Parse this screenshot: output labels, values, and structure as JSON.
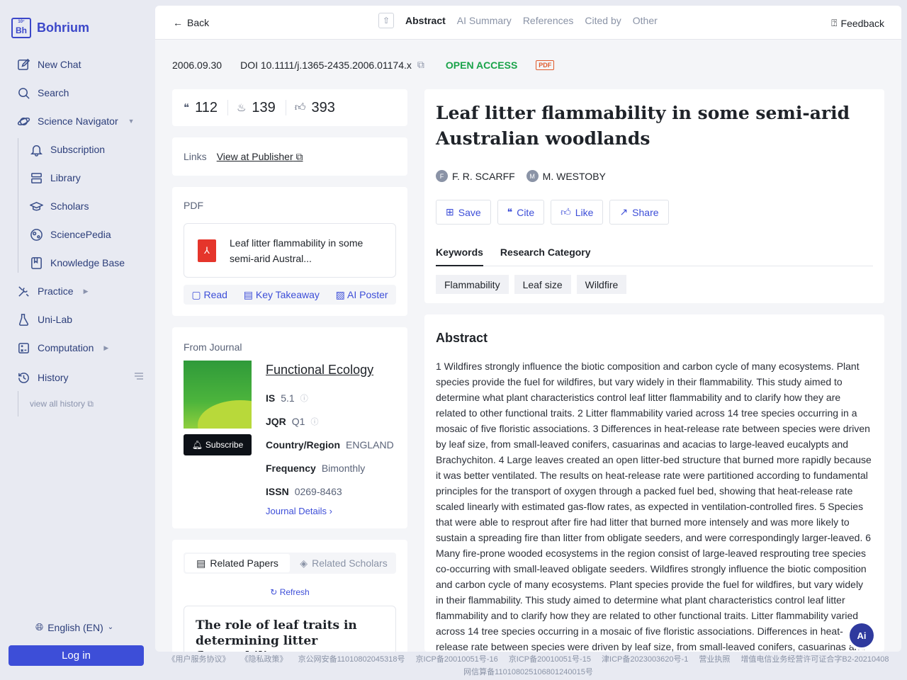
{
  "app": {
    "name": "Bohrium",
    "logo_text": "Bh",
    "logo_small": "10⁷"
  },
  "sidebar": {
    "items": [
      {
        "label": "New Chat",
        "icon": "edit-icon"
      },
      {
        "label": "Search",
        "icon": "search-icon"
      },
      {
        "label": "Science Navigator",
        "icon": "planet-icon"
      },
      {
        "label": "Subscription",
        "icon": "bell-icon"
      },
      {
        "label": "Library",
        "icon": "library-icon"
      },
      {
        "label": "Scholars",
        "icon": "graduation-cap-icon"
      },
      {
        "label": "SciencePedia",
        "icon": "globe-icon"
      },
      {
        "label": "Knowledge Base",
        "icon": "book-icon"
      },
      {
        "label": "Practice",
        "icon": "tools-icon"
      },
      {
        "label": "Uni-Lab",
        "icon": "flask-icon"
      },
      {
        "label": "Computation",
        "icon": "calculator-icon"
      },
      {
        "label": "History",
        "icon": "history-icon"
      }
    ],
    "view_all_history": "view all history",
    "language": "English (EN)",
    "login": "Log in"
  },
  "topbar": {
    "back": "Back",
    "tabs": [
      "Abstract",
      "AI Summary",
      "References",
      "Cited by",
      "Other"
    ],
    "active_tab": "Abstract",
    "feedback": "Feedback"
  },
  "meta": {
    "date": "2006.09.30",
    "doi": "DOI 10.1111/j.1365-2435.2006.01174.x",
    "open_access": "OPEN ACCESS",
    "pdf_badge": "PDF"
  },
  "stats": {
    "citations": "112",
    "hot": "139",
    "likes": "393"
  },
  "links": {
    "label": "Links",
    "publisher": "View at Publisher"
  },
  "pdf": {
    "label": "PDF",
    "title": "Leaf litter flammability in some semi-arid Austral...",
    "actions": [
      "Read",
      "Key Takeaway",
      "AI Poster"
    ]
  },
  "journal": {
    "label": "From Journal",
    "name": "Functional Ecology",
    "subscribe": "Subscribe",
    "rows": [
      {
        "key": "IS",
        "value": "5.1"
      },
      {
        "key": "JQR",
        "value": "Q1"
      },
      {
        "key": "Country/Region",
        "value": "ENGLAND"
      },
      {
        "key": "Frequency",
        "value": "Bimonthly"
      },
      {
        "key": "ISSN",
        "value": "0269-8463"
      }
    ],
    "details": "Journal Details"
  },
  "related": {
    "tabs": [
      "Related Papers",
      "Related Scholars"
    ],
    "refresh": "Refresh",
    "first_title": "The role of leaf traits in determining litter flammability"
  },
  "paper": {
    "title": "Leaf litter flammability in some semi-arid Australian woodlands",
    "authors": [
      {
        "initial": "F",
        "name": "F. R. SCARFF"
      },
      {
        "initial": "M",
        "name": "M. WESTOBY"
      }
    ],
    "actions": [
      "Save",
      "Cite",
      "Like",
      "Share"
    ],
    "kw_tabs": [
      "Keywords",
      "Research Category"
    ],
    "keywords": [
      "Flammability",
      "Leaf size",
      "Wildfire"
    ]
  },
  "abstract": {
    "heading": "Abstract",
    "text": "1 Wildfires strongly influence the biotic composition and carbon cycle of many ecosystems. Plant species provide the fuel for wildfires, but vary widely in their flammability. This study aimed to determine what plant characteristics control leaf litter flammability and to clarify how they are related to other functional traits. 2 Litter flammability varied across 14 tree species occurring in a mosaic of five floristic associations. 3 Differences in heat-release rate between species were driven by leaf size, from small-leaved conifers, casuarinas and acacias to large-leaved eucalypts and Brachychiton. 4 Large leaves created an open litter-bed structure that burned more rapidly because it was better ventilated. The results on heat-release rate were partitioned according to fundamental principles for the transport of oxygen through a packed fuel bed, showing that heat-release rate scaled linearly with estimated gas-flow rates, as expected in ventilation-controlled fires. 5 Species that were able to resprout after fire had litter that burned more intensely and was more likely to sustain a spreading fire than litter from obligate seeders, and were correspondingly larger-leaved. 6 Many fire-prone wooded ecosystems in the region consist of large-leaved resprouting tree species co-occurring with small-leaved obligate seeders. Wildfires strongly influence the biotic composition and carbon cycle of many ecosystems. Plant species provide the fuel for wildfires, but vary widely in their flammability. This study aimed to determine what plant characteristics control leaf litter flammability and to clarify how they are related to other functional traits. Litter flammability varied across 14 tree species occurring in a mosaic of five floristic associations. Differences in heat-release rate between species were driven by leaf size, from small-leaved conifers, casuarinas and acacias to large-leaved eucalypts and Brachychiton."
  },
  "ai_button": "Ai",
  "footer": {
    "line1": [
      "《用户服务协议》",
      "《隐私政策》",
      "京公网安备11010802045318号",
      "京ICP备20010051号-16",
      "京ICP备20010051号-15",
      "津ICP备2023003620号-1",
      "营业执照",
      "增值电信业务经营许可证合字B2-20210408"
    ],
    "line2": "网信算备110108025106801240015号"
  }
}
